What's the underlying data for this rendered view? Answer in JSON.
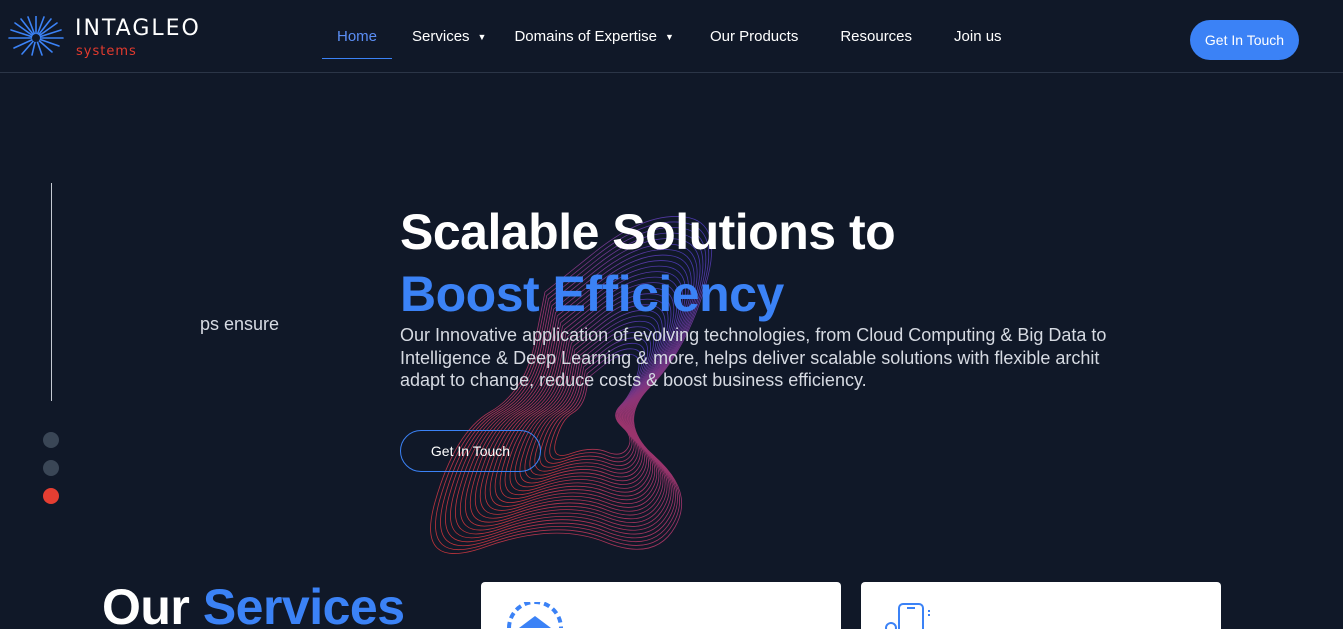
{
  "brand": {
    "name": "INTAGLEO",
    "sub": "systems",
    "colors": {
      "accent": "#3b82f6",
      "brand_red": "#e23a2e",
      "background": "#101828"
    }
  },
  "nav": {
    "items": [
      {
        "label": "Home",
        "active": true
      },
      {
        "label": "Services",
        "dropdown": true
      },
      {
        "label": "Domains of Expertise",
        "dropdown": true
      },
      {
        "label": "Our Products"
      },
      {
        "label": "Resources"
      },
      {
        "label": "Join us"
      }
    ],
    "cta": "Get In Touch"
  },
  "slider": {
    "ghost_text": "ps ensure",
    "dots": 3,
    "active_dot": 3
  },
  "hero": {
    "title_line1": "Scalable Solutions to",
    "title_line2": "Boost Efficiency",
    "description_lines": [
      "Our Innovative application of evolving technologies, from Cloud Computing & Big Data to",
      "Intelligence & Deep Learning & more, helps deliver scalable solutions with flexible archit",
      "adapt to change, reduce costs & boost business efficiency."
    ],
    "button": "Get In Touch"
  },
  "services": {
    "title_part1": "Our",
    "title_part2": "Services",
    "cards": [
      {
        "icon": "dashboard-gauge-icon"
      },
      {
        "icon": "mobile-settings-icon"
      }
    ]
  }
}
